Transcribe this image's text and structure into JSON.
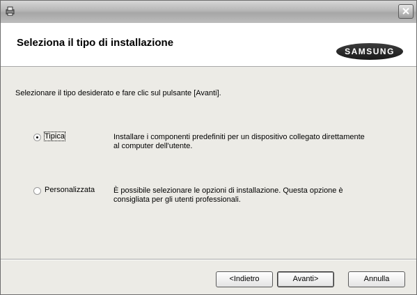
{
  "window": {
    "title": ""
  },
  "header": {
    "title": "Seleziona il tipo di installazione",
    "logo_text": "SAMSUNG"
  },
  "instruction": "Selezionare il tipo desiderato e fare clic sul pulsante [Avanti].",
  "options": [
    {
      "label": "Tipica",
      "selected": true,
      "description": [
        "Installare i componenti predefiniti per un dispositivo collegato direttamente",
        "al computer dell'utente."
      ]
    },
    {
      "label": "Personalizzata",
      "selected": false,
      "description": [
        "È possibile selezionare le opzioni di installazione. Questa opzione è",
        "consigliata per gli utenti professionali."
      ]
    }
  ],
  "buttons": {
    "back": "<Indietro",
    "next": "Avanti>",
    "cancel": "Annulla"
  },
  "icons": {
    "app": "installer-icon",
    "close": "close-icon"
  }
}
